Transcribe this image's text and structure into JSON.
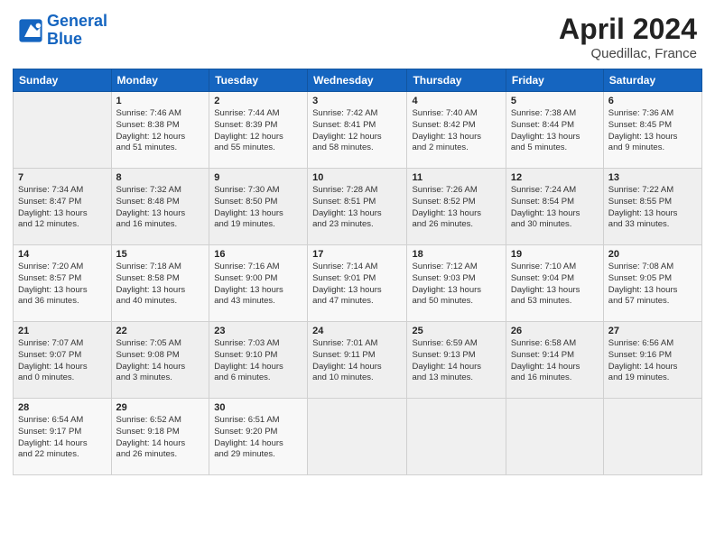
{
  "header": {
    "logo_line1": "General",
    "logo_line2": "Blue",
    "title": "April 2024",
    "subtitle": "Quedillac, France"
  },
  "columns": [
    "Sunday",
    "Monday",
    "Tuesday",
    "Wednesday",
    "Thursday",
    "Friday",
    "Saturday"
  ],
  "weeks": [
    [
      {
        "num": "",
        "info": ""
      },
      {
        "num": "1",
        "info": "Sunrise: 7:46 AM\nSunset: 8:38 PM\nDaylight: 12 hours\nand 51 minutes."
      },
      {
        "num": "2",
        "info": "Sunrise: 7:44 AM\nSunset: 8:39 PM\nDaylight: 12 hours\nand 55 minutes."
      },
      {
        "num": "3",
        "info": "Sunrise: 7:42 AM\nSunset: 8:41 PM\nDaylight: 12 hours\nand 58 minutes."
      },
      {
        "num": "4",
        "info": "Sunrise: 7:40 AM\nSunset: 8:42 PM\nDaylight: 13 hours\nand 2 minutes."
      },
      {
        "num": "5",
        "info": "Sunrise: 7:38 AM\nSunset: 8:44 PM\nDaylight: 13 hours\nand 5 minutes."
      },
      {
        "num": "6",
        "info": "Sunrise: 7:36 AM\nSunset: 8:45 PM\nDaylight: 13 hours\nand 9 minutes."
      }
    ],
    [
      {
        "num": "7",
        "info": "Sunrise: 7:34 AM\nSunset: 8:47 PM\nDaylight: 13 hours\nand 12 minutes."
      },
      {
        "num": "8",
        "info": "Sunrise: 7:32 AM\nSunset: 8:48 PM\nDaylight: 13 hours\nand 16 minutes."
      },
      {
        "num": "9",
        "info": "Sunrise: 7:30 AM\nSunset: 8:50 PM\nDaylight: 13 hours\nand 19 minutes."
      },
      {
        "num": "10",
        "info": "Sunrise: 7:28 AM\nSunset: 8:51 PM\nDaylight: 13 hours\nand 23 minutes."
      },
      {
        "num": "11",
        "info": "Sunrise: 7:26 AM\nSunset: 8:52 PM\nDaylight: 13 hours\nand 26 minutes."
      },
      {
        "num": "12",
        "info": "Sunrise: 7:24 AM\nSunset: 8:54 PM\nDaylight: 13 hours\nand 30 minutes."
      },
      {
        "num": "13",
        "info": "Sunrise: 7:22 AM\nSunset: 8:55 PM\nDaylight: 13 hours\nand 33 minutes."
      }
    ],
    [
      {
        "num": "14",
        "info": "Sunrise: 7:20 AM\nSunset: 8:57 PM\nDaylight: 13 hours\nand 36 minutes."
      },
      {
        "num": "15",
        "info": "Sunrise: 7:18 AM\nSunset: 8:58 PM\nDaylight: 13 hours\nand 40 minutes."
      },
      {
        "num": "16",
        "info": "Sunrise: 7:16 AM\nSunset: 9:00 PM\nDaylight: 13 hours\nand 43 minutes."
      },
      {
        "num": "17",
        "info": "Sunrise: 7:14 AM\nSunset: 9:01 PM\nDaylight: 13 hours\nand 47 minutes."
      },
      {
        "num": "18",
        "info": "Sunrise: 7:12 AM\nSunset: 9:03 PM\nDaylight: 13 hours\nand 50 minutes."
      },
      {
        "num": "19",
        "info": "Sunrise: 7:10 AM\nSunset: 9:04 PM\nDaylight: 13 hours\nand 53 minutes."
      },
      {
        "num": "20",
        "info": "Sunrise: 7:08 AM\nSunset: 9:05 PM\nDaylight: 13 hours\nand 57 minutes."
      }
    ],
    [
      {
        "num": "21",
        "info": "Sunrise: 7:07 AM\nSunset: 9:07 PM\nDaylight: 14 hours\nand 0 minutes."
      },
      {
        "num": "22",
        "info": "Sunrise: 7:05 AM\nSunset: 9:08 PM\nDaylight: 14 hours\nand 3 minutes."
      },
      {
        "num": "23",
        "info": "Sunrise: 7:03 AM\nSunset: 9:10 PM\nDaylight: 14 hours\nand 6 minutes."
      },
      {
        "num": "24",
        "info": "Sunrise: 7:01 AM\nSunset: 9:11 PM\nDaylight: 14 hours\nand 10 minutes."
      },
      {
        "num": "25",
        "info": "Sunrise: 6:59 AM\nSunset: 9:13 PM\nDaylight: 14 hours\nand 13 minutes."
      },
      {
        "num": "26",
        "info": "Sunrise: 6:58 AM\nSunset: 9:14 PM\nDaylight: 14 hours\nand 16 minutes."
      },
      {
        "num": "27",
        "info": "Sunrise: 6:56 AM\nSunset: 9:16 PM\nDaylight: 14 hours\nand 19 minutes."
      }
    ],
    [
      {
        "num": "28",
        "info": "Sunrise: 6:54 AM\nSunset: 9:17 PM\nDaylight: 14 hours\nand 22 minutes."
      },
      {
        "num": "29",
        "info": "Sunrise: 6:52 AM\nSunset: 9:18 PM\nDaylight: 14 hours\nand 26 minutes."
      },
      {
        "num": "30",
        "info": "Sunrise: 6:51 AM\nSunset: 9:20 PM\nDaylight: 14 hours\nand 29 minutes."
      },
      {
        "num": "",
        "info": ""
      },
      {
        "num": "",
        "info": ""
      },
      {
        "num": "",
        "info": ""
      },
      {
        "num": "",
        "info": ""
      }
    ]
  ]
}
